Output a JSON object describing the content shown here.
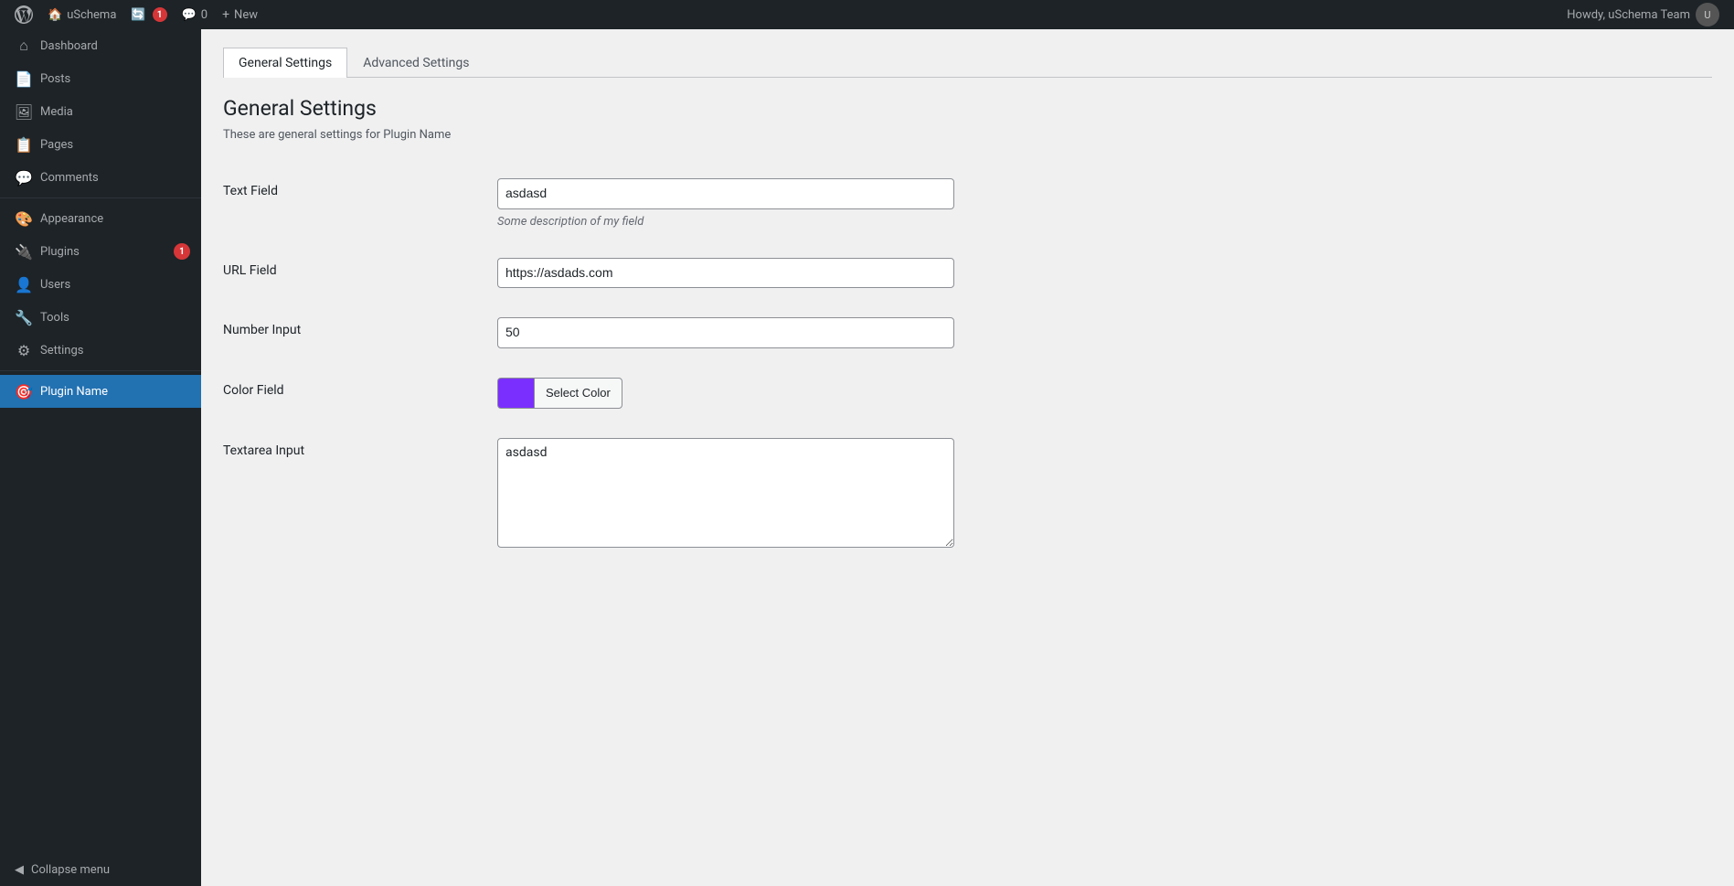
{
  "adminbar": {
    "wp_icon_title": "WordPress",
    "site_name": "uSchema",
    "updates_count": "1",
    "comments_icon_label": "Comments",
    "comments_count": "0",
    "new_label": "New",
    "user_greeting": "Howdy, uSchema Team"
  },
  "sidebar": {
    "items": [
      {
        "id": "dashboard",
        "label": "Dashboard",
        "icon": "⌂"
      },
      {
        "id": "posts",
        "label": "Posts",
        "icon": "📄"
      },
      {
        "id": "media",
        "label": "Media",
        "icon": "🖼"
      },
      {
        "id": "pages",
        "label": "Pages",
        "icon": "📋"
      },
      {
        "id": "comments",
        "label": "Comments",
        "icon": "💬"
      },
      {
        "id": "appearance",
        "label": "Appearance",
        "icon": "🎨"
      },
      {
        "id": "plugins",
        "label": "Plugins",
        "icon": "🔌",
        "badge": "1"
      },
      {
        "id": "users",
        "label": "Users",
        "icon": "👤"
      },
      {
        "id": "tools",
        "label": "Tools",
        "icon": "🔧"
      },
      {
        "id": "settings",
        "label": "Settings",
        "icon": "⚙"
      },
      {
        "id": "plugin-name",
        "label": "Plugin Name",
        "icon": "🎯",
        "active": true
      }
    ],
    "collapse_label": "Collapse menu"
  },
  "tabs": [
    {
      "id": "general",
      "label": "General Settings",
      "active": true
    },
    {
      "id": "advanced",
      "label": "Advanced Settings",
      "active": false
    }
  ],
  "main": {
    "section_title": "General Settings",
    "section_description": "These are general settings for Plugin Name",
    "fields": [
      {
        "id": "text-field",
        "label": "Text Field",
        "type": "text",
        "value": "asdasd",
        "description": "Some description of my field"
      },
      {
        "id": "url-field",
        "label": "URL Field",
        "type": "text",
        "value": "https://asdads.com",
        "description": ""
      },
      {
        "id": "number-input",
        "label": "Number Input",
        "type": "number",
        "value": "50",
        "description": ""
      },
      {
        "id": "color-field",
        "label": "Color Field",
        "type": "color",
        "color": "#7b2fff",
        "button_label": "Select Color"
      },
      {
        "id": "textarea-input",
        "label": "Textarea Input",
        "type": "textarea",
        "value": "asdasd",
        "description": ""
      }
    ]
  }
}
